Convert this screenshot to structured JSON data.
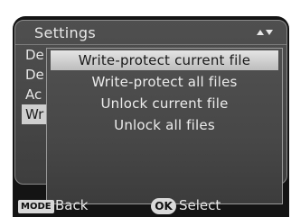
{
  "menu": {
    "title": "Settings",
    "scroll_icon": "up-down-arrows-icon",
    "background_items": [
      {
        "label": "De"
      },
      {
        "label": "De"
      },
      {
        "label": "Ac"
      },
      {
        "label": "Wr",
        "selected": true
      }
    ]
  },
  "popup": {
    "items": [
      {
        "label": "Write-protect current file",
        "highlighted": true
      },
      {
        "label": "Write-protect all files"
      },
      {
        "label": "Unlock current file"
      },
      {
        "label": "Unlock all files"
      }
    ]
  },
  "footer": {
    "mode_key": "MODE",
    "back_label": "Back",
    "ok_key": "OK",
    "select_label": "Select"
  },
  "colors": {
    "highlight": "#cfcfcf",
    "panel": "#4a4a4a",
    "text": "#e8e8e8"
  }
}
